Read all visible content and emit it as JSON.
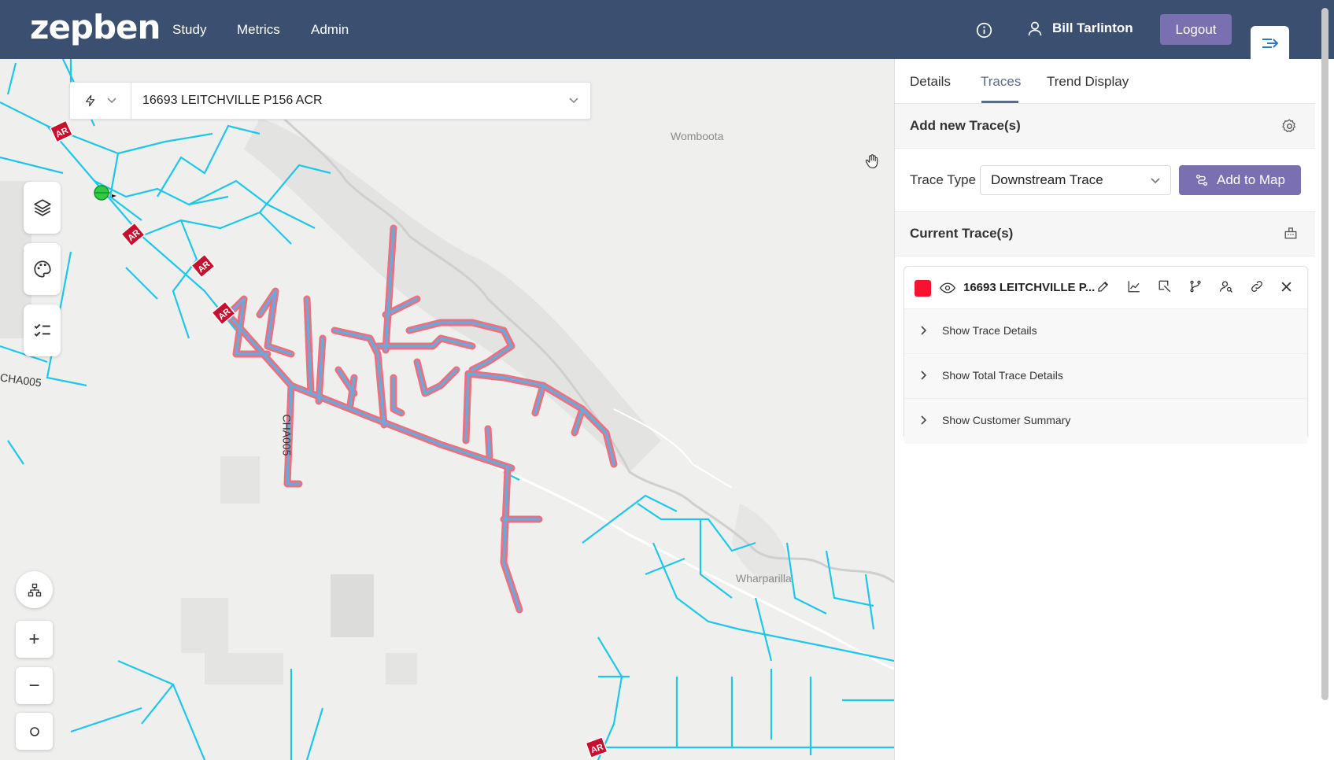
{
  "header": {
    "logo": "zepben",
    "nav": [
      "Study",
      "Metrics",
      "Admin"
    ],
    "user_name": "Bill Tarlinton",
    "logout_label": "Logout",
    "colors": {
      "header_bg": "#3b5070",
      "accent": "#7a6fb0"
    }
  },
  "map": {
    "feeder_select_value": "16693 LEITCHVILLE P156 ACR",
    "place_labels": [
      "Womboota",
      "Wharparilla",
      "CHA005",
      "CHA005"
    ],
    "marker_label": "AR",
    "colors": {
      "network_line": "#1ec7e8",
      "trace_outline": "#ee6f7d",
      "trace_inner": "#6aa9d9",
      "marker_fill": "#c8102e"
    },
    "tools": [
      "layers-icon",
      "palette-icon",
      "checklist-icon",
      "hierarchy-icon",
      "zoom-in-icon",
      "zoom-out-icon",
      "locate-icon"
    ],
    "zoom_in_label": "+",
    "zoom_out_label": "−"
  },
  "sidepanel": {
    "tabs": [
      "Details",
      "Traces",
      "Trend Display"
    ],
    "active_tab": "Traces",
    "add_section_title": "Add new Trace(s)",
    "trace_type_label": "Trace Type",
    "trace_type_value": "Downstream Trace",
    "add_to_map_label": "Add to Map",
    "current_section_title": "Current Trace(s)",
    "trace": {
      "name": "16693 LEITCHVILLE P...",
      "color": "#f5132e",
      "detail_rows": [
        "Show Trace Details",
        "Show Total Trace Details",
        "Show Customer Summary"
      ]
    }
  }
}
